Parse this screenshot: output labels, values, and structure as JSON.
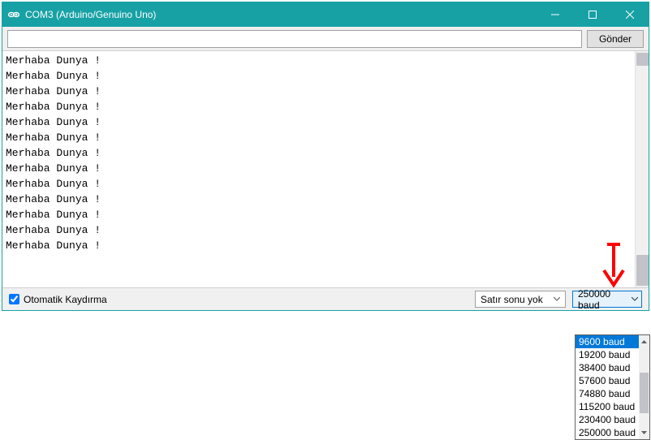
{
  "window": {
    "title": "COM3 (Arduino/Genuino Uno)"
  },
  "toolbar": {
    "input_value": "",
    "send_label": "Gönder"
  },
  "terminal": {
    "lines": [
      "Merhaba Dunya !",
      "Merhaba Dunya !",
      "Merhaba Dunya !",
      "Merhaba Dunya !",
      "Merhaba Dunya !",
      "Merhaba Dunya !",
      "Merhaba Dunya !",
      "Merhaba Dunya !",
      "Merhaba Dunya !",
      "Merhaba Dunya !",
      "Merhaba Dunya !",
      "Merhaba Dunya !",
      "Merhaba Dunya !"
    ]
  },
  "statusbar": {
    "autoscroll_label": "Otomatik Kaydırma",
    "autoscroll_checked": true,
    "line_ending_value": "Satır sonu yok",
    "baud_value": "250000 baud"
  },
  "baud_dropdown": {
    "options": [
      "9600 baud",
      "19200 baud",
      "38400 baud",
      "57600 baud",
      "74880 baud",
      "115200 baud",
      "230400 baud",
      "250000 baud"
    ],
    "selected_index": 0
  },
  "colors": {
    "titlebar": "#17a1a5",
    "selection": "#0078d7",
    "arrow": "#ff0000"
  }
}
